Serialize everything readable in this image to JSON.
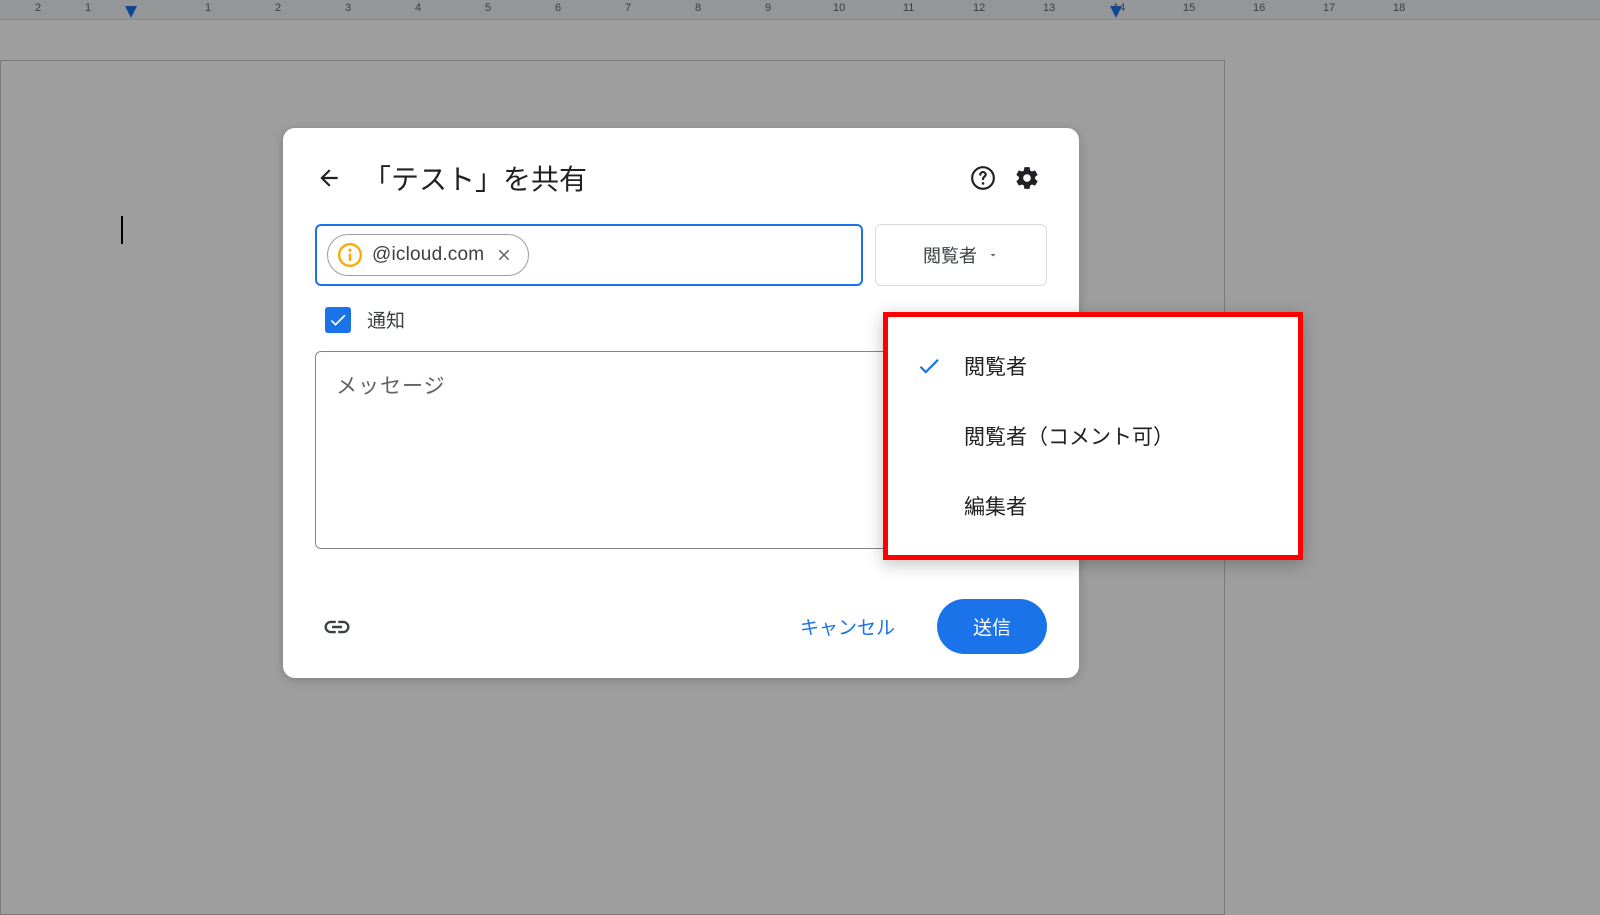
{
  "ruler": {
    "marks": [
      "2",
      "1",
      "",
      "1",
      "2",
      "3",
      "4",
      "5",
      "6",
      "7",
      "8",
      "9",
      "10",
      "11",
      "12",
      "13",
      "14",
      "15",
      "16",
      "17",
      "18"
    ]
  },
  "dialog": {
    "title": "「テスト」を共有",
    "recipient": {
      "chip_text": "@icloud.com"
    },
    "permission_selected": "閲覧者",
    "notify": {
      "label": "通知",
      "checked": true
    },
    "message_placeholder": "メッセージ",
    "footer": {
      "cancel": "キャンセル",
      "send": "送信"
    }
  },
  "dropdown": {
    "items": [
      {
        "label": "閲覧者",
        "checked": true
      },
      {
        "label": "閲覧者（コメント可）",
        "checked": false
      },
      {
        "label": "編集者",
        "checked": false
      }
    ]
  }
}
